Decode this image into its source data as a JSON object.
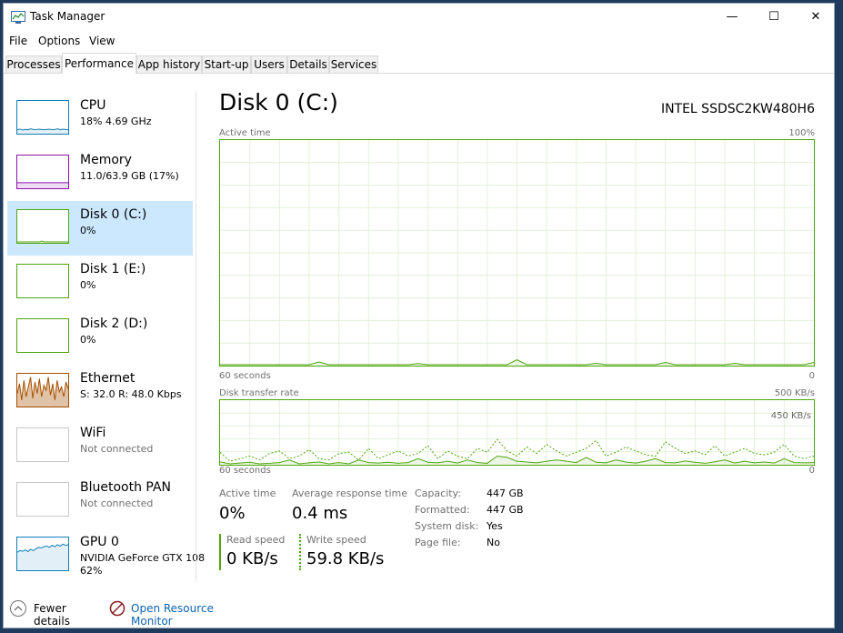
{
  "window": {
    "title": "Task Manager",
    "controls": {
      "minimize": "—",
      "maximize": "☐",
      "close": "✕"
    }
  },
  "menu": [
    "File",
    "Options",
    "View"
  ],
  "tabs": [
    "Processes",
    "Performance",
    "App history",
    "Start-up",
    "Users",
    "Details",
    "Services"
  ],
  "active_tab": "Performance",
  "sidebar": [
    {
      "name": "CPU",
      "sub": "18% 4.69 GHz",
      "color": "#117dbb",
      "selected": false
    },
    {
      "name": "Memory",
      "sub": "11.0/63.9 GB (17%)",
      "color": "#8b12ae",
      "selected": false
    },
    {
      "name": "Disk 0 (C:)",
      "sub": "0%",
      "color": "#4da60c",
      "selected": true
    },
    {
      "name": "Disk 1 (E:)",
      "sub": "0%",
      "color": "#4da60c",
      "selected": false
    },
    {
      "name": "Disk 2 (D:)",
      "sub": "0%",
      "color": "#4da60c",
      "selected": false
    },
    {
      "name": "Ethernet",
      "sub": "S: 32.0 R: 48.0 Kbps",
      "color": "#a74f01",
      "selected": false
    },
    {
      "name": "WiFi",
      "sub": "Not connected",
      "color": "#c8c8c8",
      "selected": false
    },
    {
      "name": "Bluetooth PAN",
      "sub": "Not connected",
      "color": "#c8c8c8",
      "selected": false
    },
    {
      "name": "GPU 0",
      "sub": "NVIDIA GeForce GTX 108",
      "sub2": "62%",
      "color": "#117dbb",
      "selected": false
    }
  ],
  "main": {
    "title": "Disk 0 (C:)",
    "model": "INTEL SSDSC2KW480H6",
    "active_graph": {
      "label": "Active time",
      "max": "100%",
      "x_left": "60 seconds",
      "x_right": "0"
    },
    "transfer_graph": {
      "label": "Disk transfer rate",
      "max": "500 KB/s",
      "inner": "450 KB/s",
      "x_left": "60 seconds",
      "x_right": "0"
    },
    "stats": {
      "active_time": {
        "label": "Active time",
        "value": "0%"
      },
      "avg_response": {
        "label": "Average response time",
        "value": "0.4 ms"
      },
      "read_speed": {
        "label": "Read speed",
        "value": "0 KB/s"
      },
      "write_speed": {
        "label": "Write speed",
        "value": "59.8 KB/s"
      }
    },
    "info": [
      {
        "key": "Capacity:",
        "value": "447 GB"
      },
      {
        "key": "Formatted:",
        "value": "447 GB"
      },
      {
        "key": "System disk:",
        "value": "Yes"
      },
      {
        "key": "Page file:",
        "value": "No"
      }
    ]
  },
  "series": {
    "active_pct": [
      0,
      0,
      0,
      0,
      0,
      0,
      0,
      0,
      0,
      0,
      1,
      0,
      0,
      0,
      0,
      0,
      0,
      0,
      0,
      0,
      0,
      0,
      0,
      0,
      0,
      0,
      0,
      0,
      0,
      0,
      0,
      0,
      0,
      0,
      0,
      0,
      0,
      0,
      0,
      0,
      0,
      0,
      0,
      0,
      0,
      0,
      0,
      0,
      0,
      0,
      0,
      0,
      0,
      0,
      0,
      0,
      0,
      0,
      0,
      0,
      0
    ],
    "active_bumps": [
      [
        10,
        1.2
      ],
      [
        20,
        0.5
      ],
      [
        30,
        2.2
      ],
      [
        38,
        0.6
      ],
      [
        45,
        1
      ],
      [
        52,
        0.6
      ],
      [
        60,
        1
      ]
    ],
    "read_kbs": [
      15,
      0,
      6,
      12,
      0,
      4,
      10,
      30,
      0,
      8,
      14,
      0,
      10,
      0,
      30,
      10,
      6,
      12,
      4,
      10,
      40,
      12,
      8,
      20,
      6,
      30,
      10,
      4,
      60,
      50,
      20,
      14,
      8,
      20,
      30,
      20,
      10,
      50,
      12,
      8,
      30,
      14,
      6,
      20,
      40,
      10,
      8,
      22,
      12,
      4,
      16,
      30,
      6,
      20,
      8,
      14,
      6,
      40,
      10,
      8,
      10
    ],
    "write_kbs": [
      90,
      20,
      40,
      60,
      30,
      80,
      100,
      40,
      60,
      110,
      40,
      30,
      80,
      90,
      30,
      120,
      40,
      70,
      100,
      60,
      80,
      140,
      40,
      100,
      60,
      40,
      120,
      90,
      190,
      100,
      60,
      130,
      80,
      150,
      100,
      60,
      90,
      120,
      180,
      60,
      90,
      130,
      100,
      70,
      60,
      170,
      120,
      80,
      100,
      70,
      140,
      60,
      90,
      120,
      80,
      70,
      90,
      150,
      60,
      40,
      60
    ],
    "transfer_max_kbs": 500,
    "cpu_thumb": [
      12,
      14,
      11,
      13,
      12,
      15,
      13,
      12,
      14,
      13,
      12,
      13,
      14,
      12,
      13,
      15,
      12,
      14,
      13,
      12
    ],
    "eth_thumb": [
      40,
      70,
      20,
      80,
      30,
      60,
      90,
      25,
      75,
      40,
      85,
      30,
      65,
      50,
      90,
      35,
      70,
      20,
      80,
      45,
      60,
      30,
      75,
      55
    ],
    "gpu_thumb": [
      55,
      60,
      58,
      62,
      57,
      64,
      60,
      66,
      70,
      68,
      72,
      74,
      70,
      76,
      72,
      78,
      74,
      80,
      76,
      78
    ],
    "memory_pct": 17
  }
}
